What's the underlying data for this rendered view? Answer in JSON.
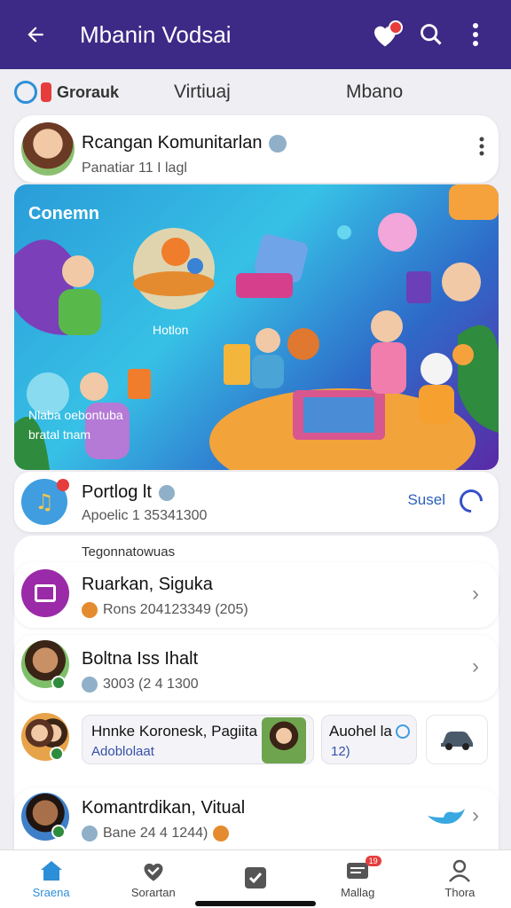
{
  "appbar": {
    "title": "Mbanin Vodsai"
  },
  "tabs": [
    {
      "label": "Grorauk"
    },
    {
      "label": "Virtiuaj"
    },
    {
      "label": "Mbano"
    }
  ],
  "profile": {
    "name": "Rcangan Komunitarlan",
    "sub": "Panatiar 11 I lagl"
  },
  "hero": {
    "caption": "Conemn",
    "bubble": "Hotlon",
    "overlay_line1": "Nlaba oebontuba",
    "overlay_line2": "bratal tnam"
  },
  "promo": {
    "title": "Portlog lt",
    "sub": "Apoelic 1 35341300",
    "action": "Susel"
  },
  "section_label": "Tegonnatowuas",
  "list": [
    {
      "title": "Ruarkan, Sigukа",
      "sub": "Rons 204123349 (205)"
    },
    {
      "title": "Boltna Iss Ihalt",
      "sub": "3003 (2 4 1300"
    }
  ],
  "group_row": {
    "card1_title": "Hnnke Koronesk, Pagiita",
    "card1_sub": "Adoblolaat",
    "card2_title": "Auohel la",
    "card2_sub": "12)"
  },
  "last_item": {
    "title": "Komantrdikan, Vitual",
    "sub": "Bane 24 4 1244)"
  },
  "nav": [
    {
      "label": "Sraena"
    },
    {
      "label": "Sorartan"
    },
    {
      "label": ""
    },
    {
      "label": "Mallag",
      "badge": "19"
    },
    {
      "label": "Thora"
    }
  ],
  "colors": {
    "primary": "#3d2a86",
    "accent": "#2d8fd8",
    "badge": "#e63c3c",
    "purple": "#9b2aa8"
  }
}
